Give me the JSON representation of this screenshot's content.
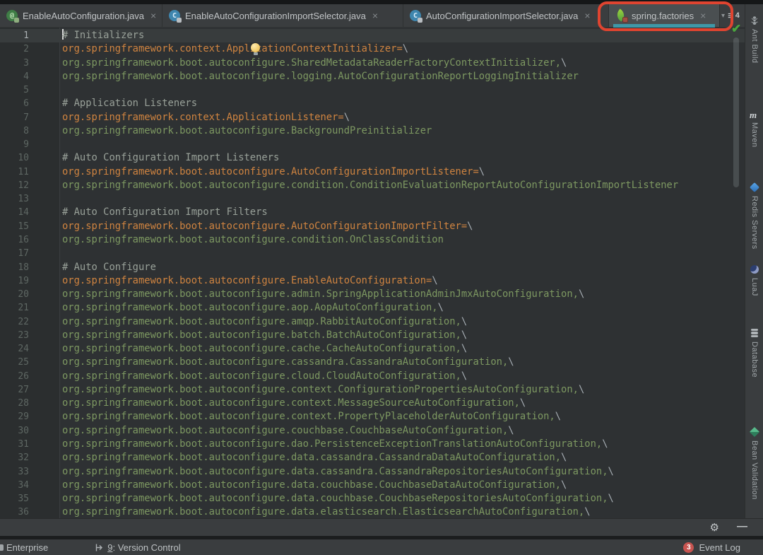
{
  "ui": {
    "close_glyph": "×",
    "dropdown_glyph": "▾",
    "tab_list_glyph": "≡",
    "gear_glyph": "⚙",
    "minimize_glyph": "—",
    "check_glyph": "✔"
  },
  "colors": {
    "editor_bg": "#2e3133",
    "tabbar_bg": "#3a3d3f",
    "active_tab_underline": "#3f98a8",
    "annotation_box_red": "#df4430",
    "key_orange": "#d08440",
    "value_green": "#7d9861",
    "comment_gray": "#99a199",
    "event_badge_red": "#c75450",
    "check_green": "#4aa63f"
  },
  "tabs": [
    {
      "label": "EnableAutoConfiguration.java",
      "icon": "annotation-icon",
      "icon_letter": "@"
    },
    {
      "label": "EnableAutoConfigurationImportSelector.java",
      "icon": "class-icon",
      "icon_letter": "C"
    },
    {
      "label": "AutoConfigurationImportSelector.java",
      "icon": "class-icon",
      "icon_letter": "C"
    },
    {
      "label": "spring.factories",
      "icon": "spring-leaf-icon",
      "active": true,
      "annotated": true
    }
  ],
  "tab_overflow": {
    "count": "4"
  },
  "editor": {
    "lines": [
      {
        "num": "1",
        "type": "comment",
        "text": "# Initializers",
        "caret": true,
        "current": true
      },
      {
        "num": "2",
        "type": "key",
        "text": "org.springframework.context.ApplicationContextInitializer=\\",
        "bulb": true
      },
      {
        "num": "3",
        "type": "value",
        "text": "org.springframework.boot.autoconfigure.SharedMetadataReaderFactoryContextInitializer,\\"
      },
      {
        "num": "4",
        "type": "value",
        "text": "org.springframework.boot.autoconfigure.logging.AutoConfigurationReportLoggingInitializer"
      },
      {
        "num": "5",
        "type": "blank",
        "text": ""
      },
      {
        "num": "6",
        "type": "comment",
        "text": "# Application Listeners"
      },
      {
        "num": "7",
        "type": "key",
        "text": "org.springframework.context.ApplicationListener=\\"
      },
      {
        "num": "8",
        "type": "value",
        "text": "org.springframework.boot.autoconfigure.BackgroundPreinitializer"
      },
      {
        "num": "9",
        "type": "blank",
        "text": ""
      },
      {
        "num": "10",
        "type": "comment",
        "text": "# Auto Configuration Import Listeners"
      },
      {
        "num": "11",
        "type": "key",
        "text": "org.springframework.boot.autoconfigure.AutoConfigurationImportListener=\\"
      },
      {
        "num": "12",
        "type": "value",
        "text": "org.springframework.boot.autoconfigure.condition.ConditionEvaluationReportAutoConfigurationImportListener"
      },
      {
        "num": "13",
        "type": "blank",
        "text": ""
      },
      {
        "num": "14",
        "type": "comment",
        "text": "# Auto Configuration Import Filters"
      },
      {
        "num": "15",
        "type": "key",
        "text": "org.springframework.boot.autoconfigure.AutoConfigurationImportFilter=\\"
      },
      {
        "num": "16",
        "type": "value",
        "text": "org.springframework.boot.autoconfigure.condition.OnClassCondition"
      },
      {
        "num": "17",
        "type": "blank",
        "text": ""
      },
      {
        "num": "18",
        "type": "comment",
        "text": "# Auto Configure"
      },
      {
        "num": "19",
        "type": "key",
        "text": "org.springframework.boot.autoconfigure.EnableAutoConfiguration=\\"
      },
      {
        "num": "20",
        "type": "value",
        "text": "org.springframework.boot.autoconfigure.admin.SpringApplicationAdminJmxAutoConfiguration,\\"
      },
      {
        "num": "21",
        "type": "value",
        "text": "org.springframework.boot.autoconfigure.aop.AopAutoConfiguration,\\"
      },
      {
        "num": "22",
        "type": "value",
        "text": "org.springframework.boot.autoconfigure.amqp.RabbitAutoConfiguration,\\"
      },
      {
        "num": "23",
        "type": "value",
        "text": "org.springframework.boot.autoconfigure.batch.BatchAutoConfiguration,\\"
      },
      {
        "num": "24",
        "type": "value",
        "text": "org.springframework.boot.autoconfigure.cache.CacheAutoConfiguration,\\"
      },
      {
        "num": "25",
        "type": "value",
        "text": "org.springframework.boot.autoconfigure.cassandra.CassandraAutoConfiguration,\\"
      },
      {
        "num": "26",
        "type": "value",
        "text": "org.springframework.boot.autoconfigure.cloud.CloudAutoConfiguration,\\"
      },
      {
        "num": "27",
        "type": "value",
        "text": "org.springframework.boot.autoconfigure.context.ConfigurationPropertiesAutoConfiguration,\\"
      },
      {
        "num": "28",
        "type": "value",
        "text": "org.springframework.boot.autoconfigure.context.MessageSourceAutoConfiguration,\\"
      },
      {
        "num": "29",
        "type": "value",
        "text": "org.springframework.boot.autoconfigure.context.PropertyPlaceholderAutoConfiguration,\\"
      },
      {
        "num": "30",
        "type": "value",
        "text": "org.springframework.boot.autoconfigure.couchbase.CouchbaseAutoConfiguration,\\"
      },
      {
        "num": "31",
        "type": "value",
        "text": "org.springframework.boot.autoconfigure.dao.PersistenceExceptionTranslationAutoConfiguration,\\"
      },
      {
        "num": "32",
        "type": "value",
        "text": "org.springframework.boot.autoconfigure.data.cassandra.CassandraDataAutoConfiguration,\\"
      },
      {
        "num": "33",
        "type": "value",
        "text": "org.springframework.boot.autoconfigure.data.cassandra.CassandraRepositoriesAutoConfiguration,\\"
      },
      {
        "num": "34",
        "type": "value",
        "text": "org.springframework.boot.autoconfigure.data.couchbase.CouchbaseDataAutoConfiguration,\\"
      },
      {
        "num": "35",
        "type": "value",
        "text": "org.springframework.boot.autoconfigure.data.couchbase.CouchbaseRepositoriesAutoConfiguration,\\"
      },
      {
        "num": "36",
        "type": "value",
        "text": "org.springframework.boot.autoconfigure.data.elasticsearch.ElasticsearchAutoConfiguration,\\"
      }
    ]
  },
  "right_toolbar": {
    "items": [
      {
        "label": "Ant Build",
        "icon": "ant-icon"
      },
      {
        "label": "Maven",
        "icon": "maven-icon",
        "icon_letter": "m"
      },
      {
        "label": "Redis Servers",
        "icon": "redis-icon"
      },
      {
        "label": "LuaJ",
        "icon": "luaj-icon"
      },
      {
        "label": "Database",
        "icon": "database-icon"
      },
      {
        "label": "Bean Validation",
        "icon": "bean-validation-icon"
      }
    ]
  },
  "status_bar": {
    "left_text": "Enterprise",
    "vcs_number": "9",
    "vcs_label": ": Version Control",
    "event_log": {
      "count": "3",
      "label": "Event Log"
    }
  }
}
